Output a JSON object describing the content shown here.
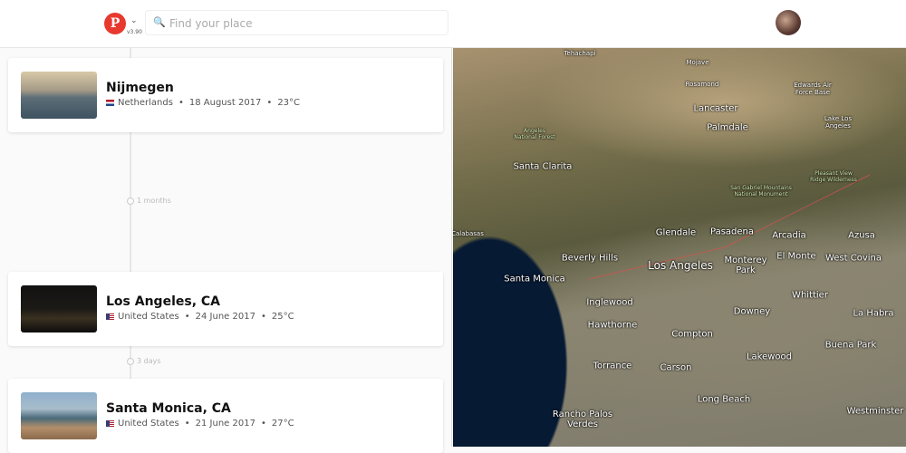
{
  "header": {
    "logo_text": "P",
    "version": "v3.90",
    "search_placeholder": "Find your place",
    "search_value": ""
  },
  "timeline": {
    "entries": [
      {
        "title": "Nijmegen",
        "country": "Netherlands",
        "date": "18 August 2017",
        "temp": "23°C"
      },
      {
        "title": "Los Angeles, CA",
        "country": "United States",
        "date": "24 June 2017",
        "temp": "25°C"
      },
      {
        "title": "Santa Monica, CA",
        "country": "United States",
        "date": "21 June 2017",
        "temp": "27°C"
      }
    ],
    "gaps": [
      "1 months",
      "3 days"
    ]
  },
  "map": {
    "labels": [
      "Tehachapi",
      "Mojave",
      "Rosamond",
      "Edwards Air Force Base",
      "Lancaster",
      "Palmdale",
      "Lake Los Angeles",
      "Angeles National Forest",
      "Santa Clarita",
      "San Gabriel Mountains National Monument",
      "Pleasant View Ridge Wilderness",
      "Calabasas",
      "Glendale",
      "Pasadena",
      "Arcadia",
      "Azusa",
      "Beverly Hills",
      "Los Angeles",
      "Monterey Park",
      "El Monte",
      "West Covina",
      "Santa Monica",
      "Whittier",
      "Inglewood",
      "Downey",
      "La Habra",
      "Hawthorne",
      "Compton",
      "Buena Park",
      "Lakewood",
      "Torrance",
      "Carson",
      "Long Beach",
      "Westminster",
      "Rancho Palos Verdes"
    ]
  }
}
